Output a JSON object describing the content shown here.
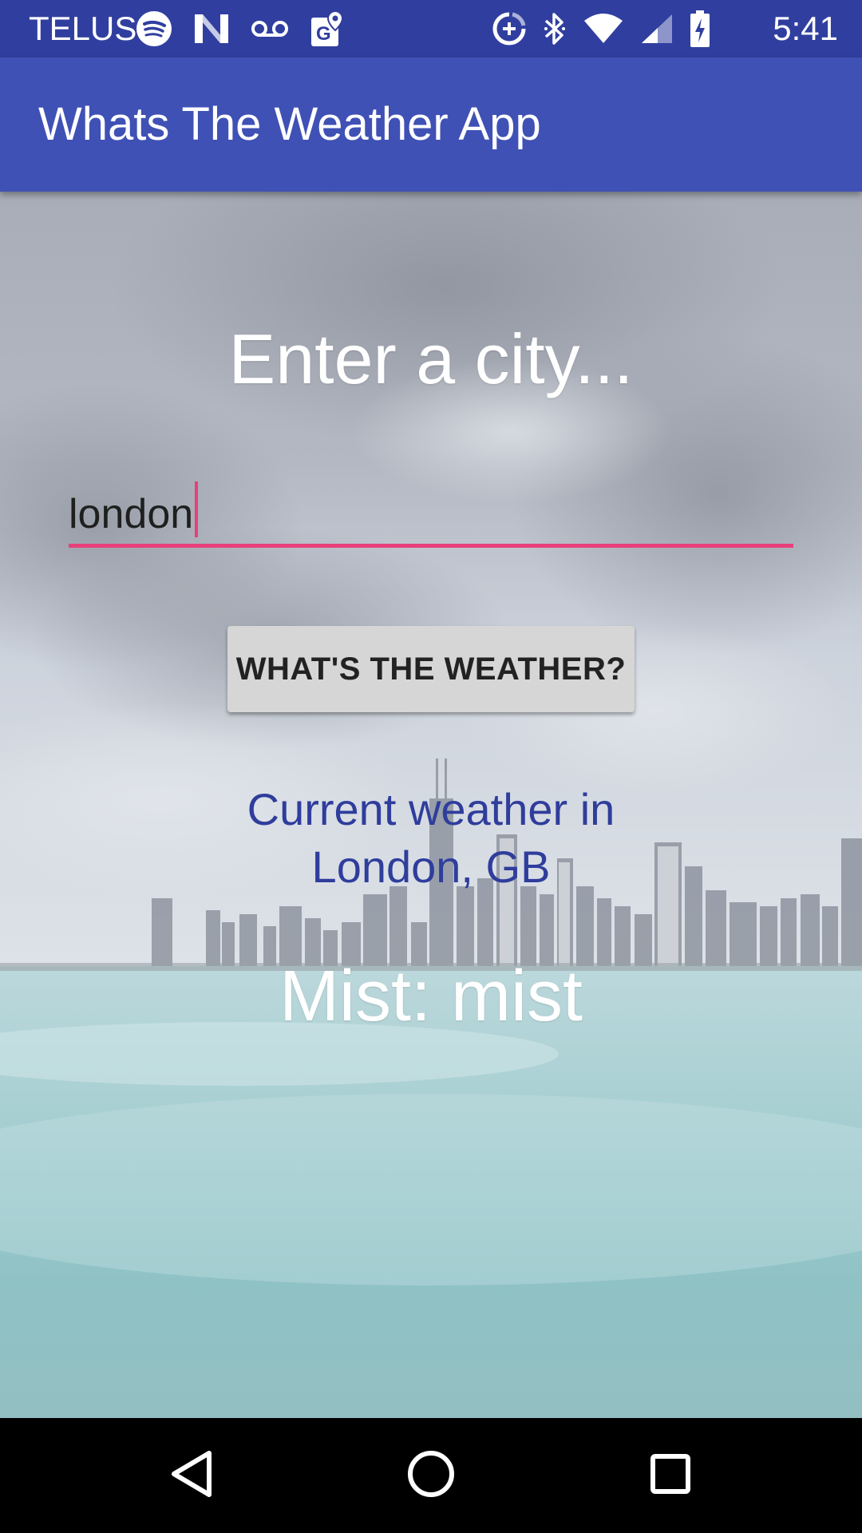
{
  "status_bar": {
    "carrier": "TELUS",
    "time": "5:41",
    "left_icons": [
      "spotify-icon",
      "n-logo-icon",
      "voicemail-icon",
      "maps-icon"
    ],
    "right_icons": [
      "data-saver-icon",
      "bluetooth-icon",
      "wifi-icon",
      "signal-icon",
      "battery-charging-icon"
    ]
  },
  "app_bar": {
    "title": "Whats The Weather App",
    "color": "#3f51b5",
    "status_color": "#303f9f"
  },
  "main": {
    "prompt": "Enter a city...",
    "city_input": {
      "value": "london",
      "accent_color": "#e8407a"
    },
    "button_label": "WHAT'S THE WEATHER?",
    "result_heading_line1": "Current weather in",
    "result_heading_line2": "London, GB",
    "result_value": "Mist: mist",
    "heading_color": "#2f3d9c"
  },
  "nav_bar": {
    "buttons": [
      "back-icon",
      "home-icon",
      "recents-icon"
    ]
  }
}
